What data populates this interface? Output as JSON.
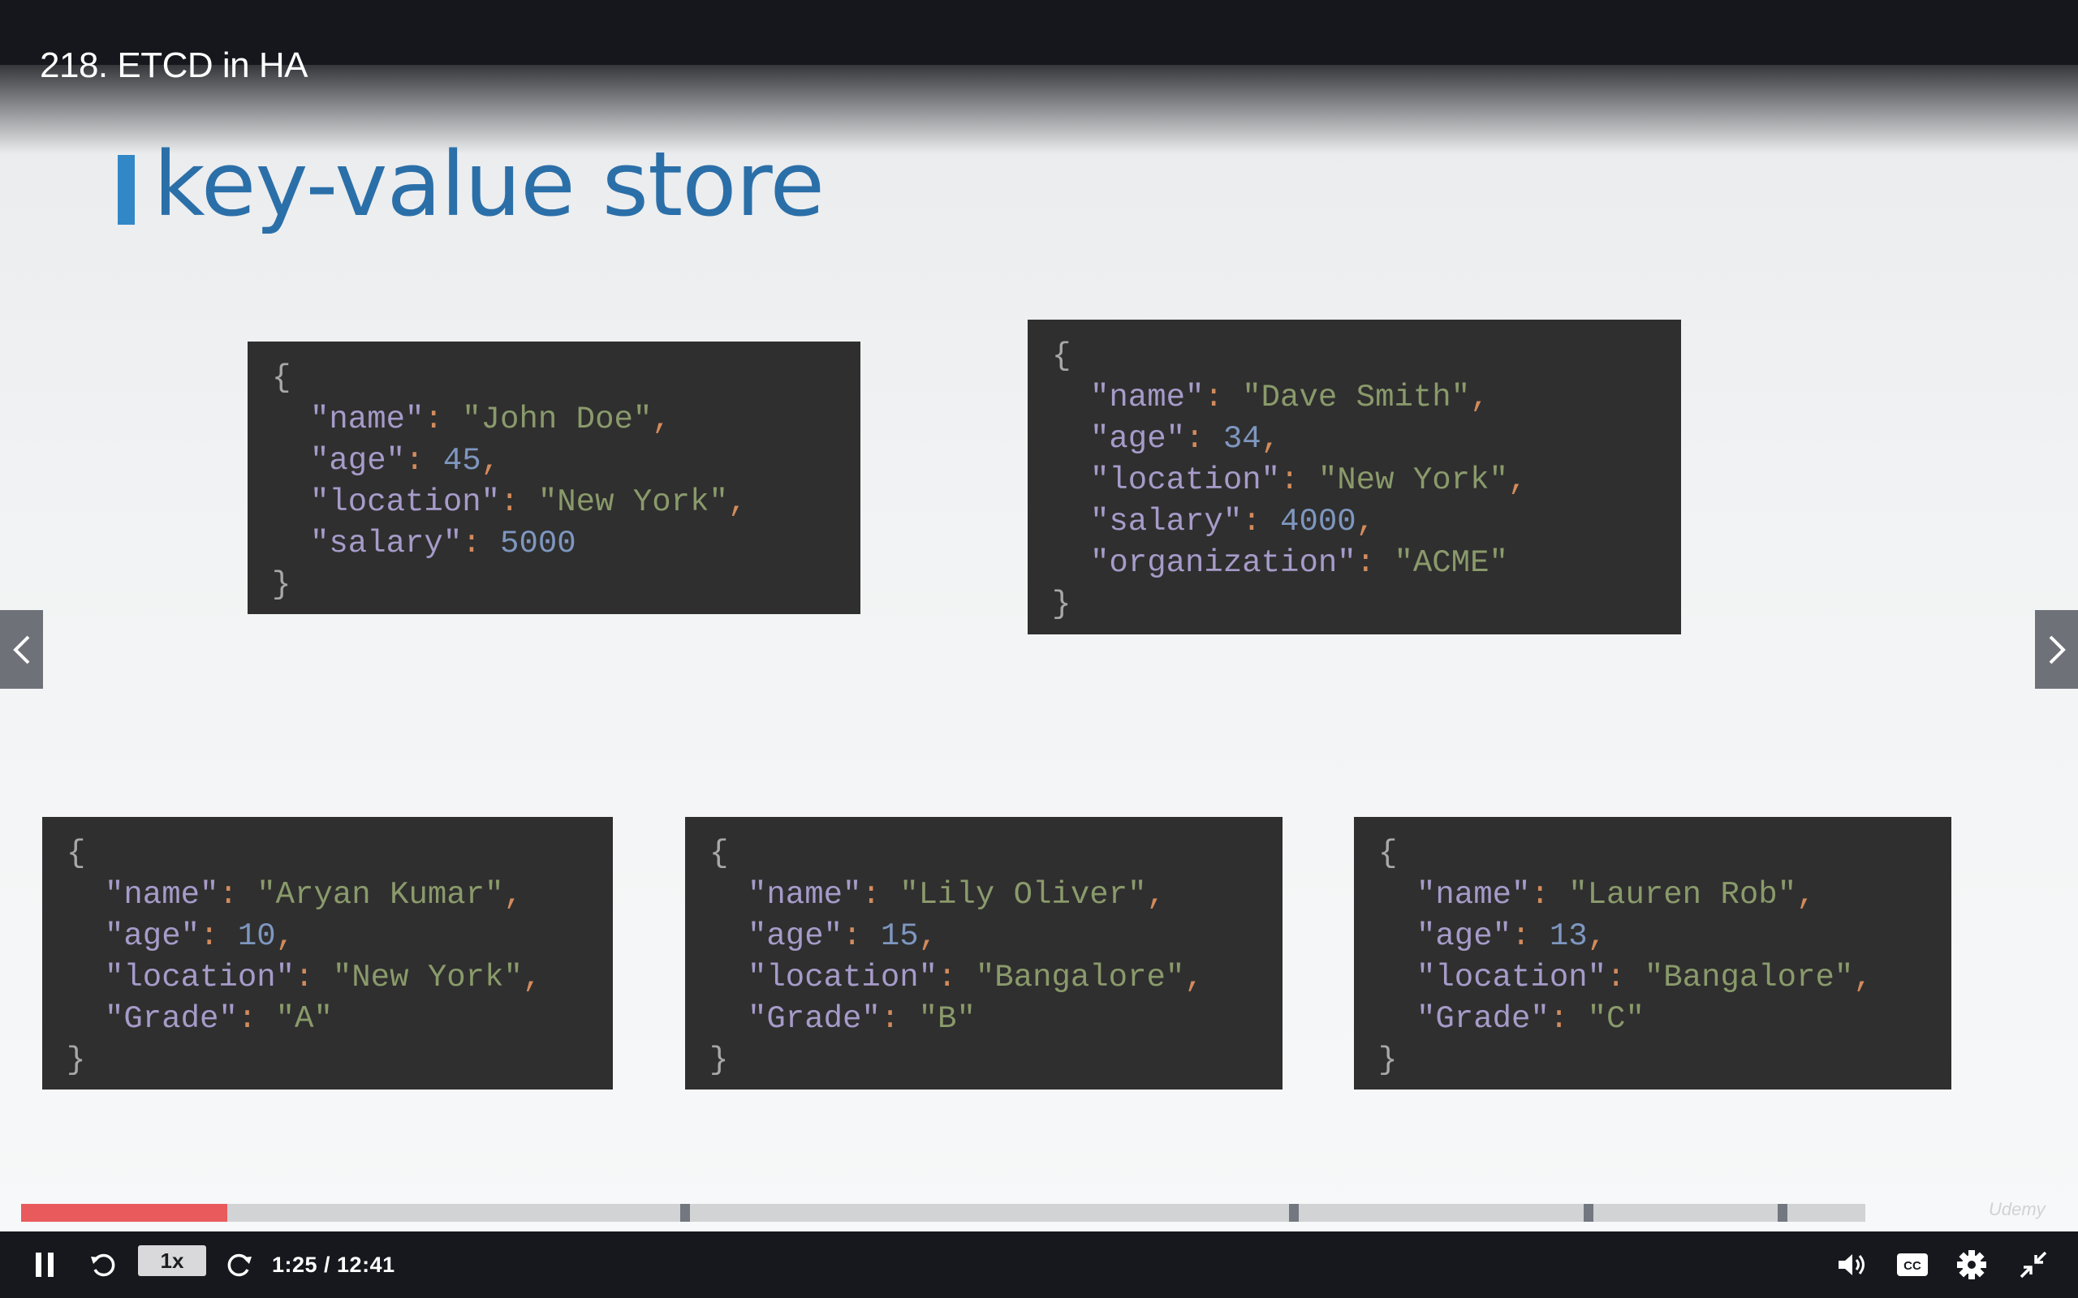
{
  "lecture": {
    "title": "218. ETCD in HA"
  },
  "slide": {
    "title": "key-value store",
    "records": [
      {
        "fields": [
          {
            "key": "\"name\"",
            "value": "\"John Doe\"",
            "type": "string"
          },
          {
            "key": "\"age\"",
            "value": "45",
            "type": "number"
          },
          {
            "key": "\"location\"",
            "value": "\"New York\"",
            "type": "string"
          },
          {
            "key": "\"salary\"",
            "value": "5000",
            "type": "number"
          }
        ]
      },
      {
        "fields": [
          {
            "key": "\"name\"",
            "value": "\"Dave Smith\"",
            "type": "string"
          },
          {
            "key": "\"age\"",
            "value": "34",
            "type": "number"
          },
          {
            "key": "\"location\"",
            "value": "\"New York\"",
            "type": "string"
          },
          {
            "key": "\"salary\"",
            "value": "4000",
            "type": "number"
          },
          {
            "key": "\"organization\"",
            "value": "\"ACME\"",
            "type": "string"
          }
        ]
      },
      {
        "fields": [
          {
            "key": "\"name\"",
            "value": "\"Aryan Kumar\"",
            "type": "string"
          },
          {
            "key": "\"age\"",
            "value": "10",
            "type": "number"
          },
          {
            "key": "\"location\"",
            "value": "\"New York\"",
            "type": "string"
          },
          {
            "key": "\"Grade\"",
            "value": "\"A\"",
            "type": "string"
          }
        ]
      },
      {
        "fields": [
          {
            "key": "\"name\"",
            "value": "\"Lily Oliver\"",
            "type": "string"
          },
          {
            "key": "\"age\"",
            "value": "15",
            "type": "number"
          },
          {
            "key": "\"location\"",
            "value": "\"Bangalore\"",
            "type": "string"
          },
          {
            "key": "\"Grade\"",
            "value": "\"B\"",
            "type": "string"
          }
        ]
      },
      {
        "fields": [
          {
            "key": "\"name\"",
            "value": "\"Lauren Rob\"",
            "type": "string"
          },
          {
            "key": "\"age\"",
            "value": "13",
            "type": "number"
          },
          {
            "key": "\"location\"",
            "value": "\"Bangalore\"",
            "type": "string"
          },
          {
            "key": "\"Grade\"",
            "value": "\"C\"",
            "type": "string"
          }
        ]
      }
    ]
  },
  "player": {
    "speed_label": "1x",
    "time_display": "1:25 / 12:41",
    "current_time": "1:25",
    "duration": "12:41",
    "progress_fraction": 0.112,
    "chapter_mark_fractions": [
      0.36,
      0.69,
      0.85,
      0.955
    ],
    "watermark": "Udemy",
    "icons": [
      "pause-icon",
      "rewind-icon",
      "forward-icon",
      "volume-icon",
      "captions-icon",
      "settings-icon",
      "exit-fullscreen-icon",
      "chevron-left-icon",
      "chevron-right-icon"
    ]
  },
  "colors": {
    "accent_red": "#e85a5c",
    "title_blue": "#2b6fa9",
    "title_bar_blue": "#3287c7",
    "code_bg": "#2f2f2f",
    "json_key": "#a69bc9",
    "json_string": "#8a9a6b",
    "json_number": "#7e97c0",
    "json_punct": "#d38b5c"
  }
}
